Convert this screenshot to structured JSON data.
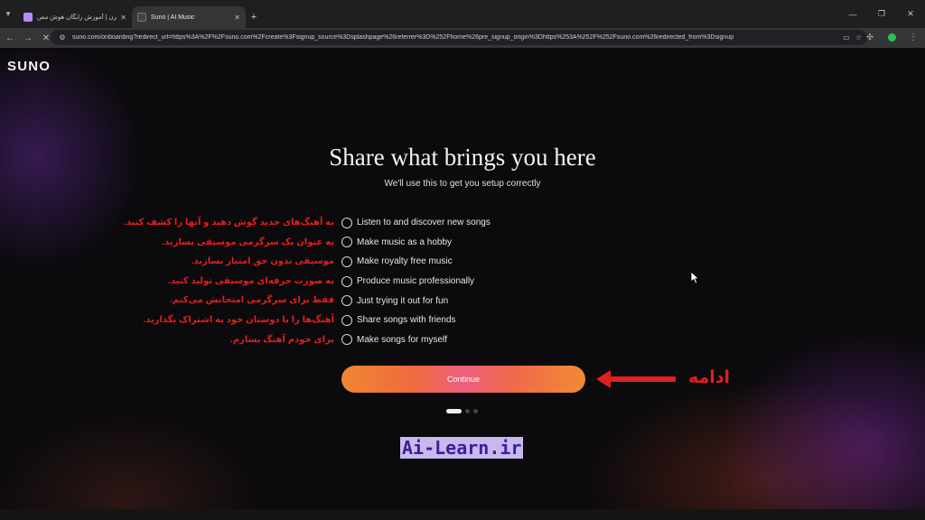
{
  "browser": {
    "tabs": [
      {
        "label": "آن لرن | آموزش رایگان هوش مص...",
        "active": false
      },
      {
        "label": "Suno | AI Music",
        "active": true
      }
    ],
    "url": "suno.com/onboarding?redirect_url=https%3A%2F%2Fsuno.com%2Fcreate%3Fsignup_source%3Dsplashpage%26referrer%3D%252Fhome%26pre_signup_origin%3Dhttps%253A%252F%252Fsuno.com%26redirected_from%3Dsignup"
  },
  "page": {
    "logo": "SUNO",
    "title": "Share what brings you here",
    "subtitle": "We'll use this to get you setup correctly",
    "options": [
      {
        "label": "Listen to and discover new songs",
        "note": "به آهنگ‌های جدید گوش دهید و آنها را کشف کنید."
      },
      {
        "label": "Make music as a hobby",
        "note": "به عنوان یک سرگرمی موسیقی بسازید."
      },
      {
        "label": "Make royalty free music",
        "note": "موسیقی بدون حق امتیاز بسازید."
      },
      {
        "label": "Produce music professionally",
        "note": "به صورت حرفه‌ای موسیقی تولید کنید."
      },
      {
        "label": "Just trying it out for fun",
        "note": "فقط برای سرگرمی امتحانش می‌کنم."
      },
      {
        "label": "Share songs with friends",
        "note": "آهنگ‌ها را با دوستان خود به اشتراک بگذارید."
      },
      {
        "label": "Make songs for myself",
        "note": "برای خودم آهنگ بسازم."
      }
    ],
    "continue_label": "Continue",
    "continue_note": "ادامه",
    "watermark": "Ai-Learn.ir",
    "pagination": {
      "current": 1,
      "total": 3
    }
  },
  "colors": {
    "annotation": "#e11f1f",
    "button_start": "#f0862f",
    "button_mid": "#ec5f7e"
  }
}
